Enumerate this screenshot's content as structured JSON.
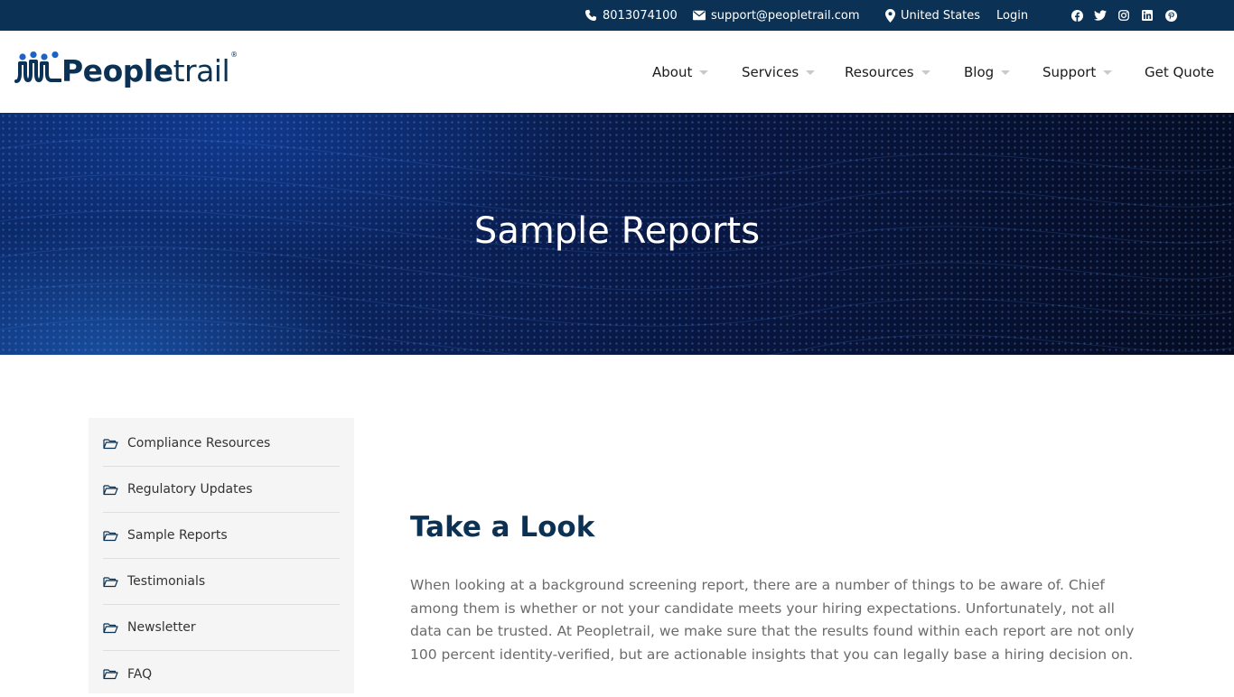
{
  "topbar": {
    "phone": "8013074100",
    "email": "support@peopletrail.com",
    "location": "United States",
    "login": "Login",
    "social": [
      "facebook-icon",
      "twitter-icon",
      "instagram-icon",
      "linkedin-icon",
      "pinterest-icon"
    ]
  },
  "logo": {
    "text_bold": "People",
    "text_light": "trail",
    "registered": "®"
  },
  "nav": {
    "about": "About",
    "services": "Services",
    "resources": "Resources",
    "blog": "Blog",
    "support": "Support",
    "get_quote": "Get Quote"
  },
  "hero": {
    "title": "Sample Reports"
  },
  "sidebar": {
    "items": [
      {
        "label": "Compliance Resources"
      },
      {
        "label": "Regulatory Updates"
      },
      {
        "label": "Sample Reports"
      },
      {
        "label": "Testimonials"
      },
      {
        "label": "Newsletter"
      },
      {
        "label": "FAQ"
      }
    ]
  },
  "main": {
    "heading": "Take a Look",
    "paragraph": "When looking at a background screening report, there are a number of things to be aware of. Chief among them is whether or not your candidate meets your hiring expectations. Unfortunately, not all data can be trusted. At Peopletrail, we make sure that the results found within each report are not only 100 percent identity-verified, but are actionable insights that you can legally base a hiring decision on."
  },
  "colors": {
    "topbar_bg": "#0b3254",
    "brand_navy": "#0b3254",
    "sidebar_bg": "#f5f5f5",
    "body_text": "#6b6b6b"
  }
}
